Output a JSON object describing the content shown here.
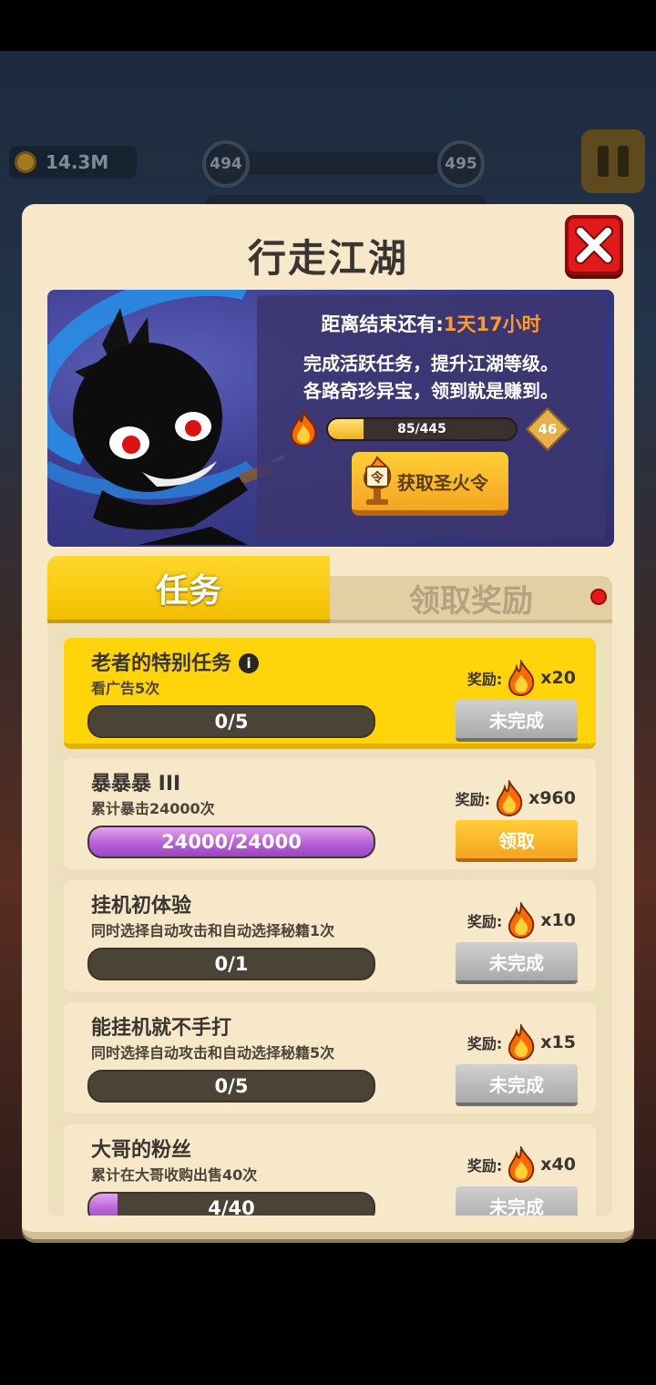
{
  "hud": {
    "coins": "14.3M",
    "level_left": "494",
    "level_right": "495"
  },
  "dialog": {
    "title": "行走江湖",
    "countdown_label": "距离结束还有:",
    "countdown_value": "1天17小时",
    "desc_line1": "完成活跃任务，提升江湖等级。",
    "desc_line2": "各路奇珍异宝，领到就是赚到。",
    "xp_text": "85/445",
    "xp_progress": 0.19,
    "level": "46",
    "get_token_label": "获取圣火令",
    "token_glyph": "令"
  },
  "tabs": {
    "tasks": "任务",
    "rewards": "领取奖励"
  },
  "tasks": [
    {
      "name": "老者的特别任务",
      "sub": "看广告5次",
      "progress_text": "0/5",
      "progress": 0,
      "reward_label": "奖励:",
      "reward_amount": "x20",
      "button": "未完成"
    },
    {
      "name": "暴暴暴 III",
      "sub": "累计暴击24000次",
      "progress_text": "24000/24000",
      "progress": 1,
      "reward_label": "奖励:",
      "reward_amount": "x960",
      "button": "领取"
    },
    {
      "name": "挂机初体验",
      "sub": "同时选择自动攻击和自动选择秘籍1次",
      "progress_text": "0/1",
      "progress": 0,
      "reward_label": "奖励:",
      "reward_amount": "x10",
      "button": "未完成"
    },
    {
      "name": "能挂机就不手打",
      "sub": "同时选择自动攻击和自动选择秘籍5次",
      "progress_text": "0/5",
      "progress": 0,
      "reward_label": "奖励:",
      "reward_amount": "x15",
      "button": "未完成"
    },
    {
      "name": "大哥的粉丝",
      "sub": "累计在大哥收购出售40次",
      "progress_text": "4/40",
      "progress": 0.1,
      "reward_label": "奖励:",
      "reward_amount": "x40",
      "button": "未完成"
    }
  ],
  "colors": {
    "accent": "#ffd40a",
    "progress_purple": "#b561d6",
    "close_red": "#e21a1a"
  }
}
